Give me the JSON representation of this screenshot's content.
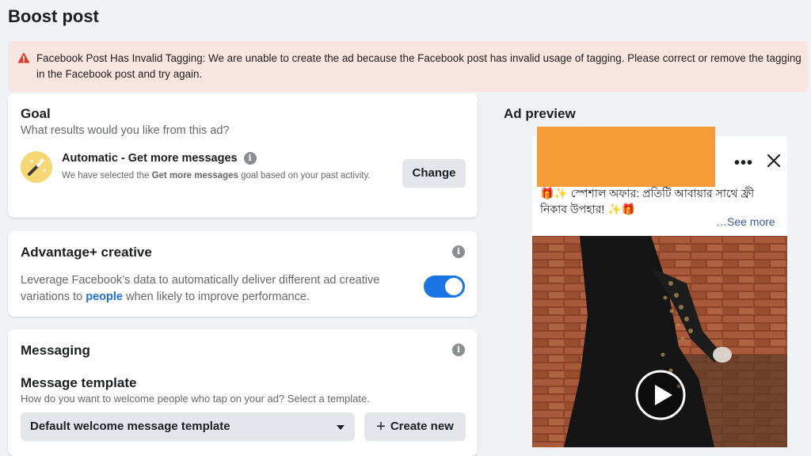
{
  "page_title": "Boost post",
  "alert": {
    "message": "Facebook Post Has Invalid Tagging: We are unable to create the ad because the Facebook post has invalid usage of tagging. Please correct or remove the tagging in the Facebook post and try again.",
    "color": "#f9e5e0",
    "icon": "warning-icon"
  },
  "goal": {
    "heading": "Goal",
    "subheading": "What results would you like from this ad?",
    "option_title": "Automatic - Get more messages",
    "desc_before": "We have selected the ",
    "desc_bold": "Get more messages",
    "desc_after": " goal based on your past activity.",
    "change_label": "Change"
  },
  "advantage": {
    "heading": "Advantage+ creative",
    "desc_before": "Leverage Facebook’s data to automatically deliver different ad creative variations to ",
    "desc_link": "people",
    "desc_after": " when likely to improve performance.",
    "toggle_on": true,
    "accent": "#1b74e4"
  },
  "messaging": {
    "heading": "Messaging",
    "template_heading": "Message template",
    "template_sub": "How do you want to welcome people who tap on your ad? Select a template.",
    "selected_template": "Default welcome message template",
    "create_label": "Create new"
  },
  "preview": {
    "heading": "Ad preview",
    "post_text": "🎁✨ স্পেশাল অফার: প্রতিটি আবায়ার সাথে ফ্রী নিকাব উপহার! ✨🎁",
    "see_more": "…See more"
  }
}
